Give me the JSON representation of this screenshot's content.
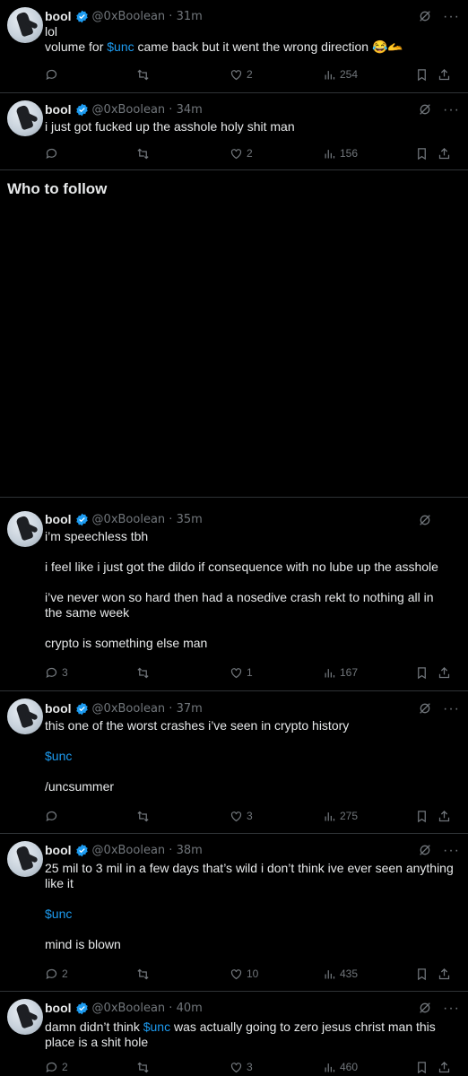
{
  "author": {
    "name": "bool",
    "handle": "@0xBoolean"
  },
  "who_to_follow": "Who to follow",
  "tweets": [
    {
      "time": "31m",
      "lines": [
        {
          "pre": "lol"
        },
        {
          "pre": "volume for ",
          "cash": "$unc",
          "post": " came back but it went the wrong direction 😂🫴"
        }
      ],
      "reply": "",
      "repost": "",
      "like": "2",
      "views": "254"
    },
    {
      "time": "34m",
      "lines": [
        {
          "pre": "i just got fucked up the asshole holy shit man"
        }
      ],
      "reply": "",
      "repost": "",
      "like": "2",
      "views": "156"
    },
    {
      "time": "35m",
      "lines": [
        {
          "pre": "i’m speechless tbh"
        },
        {
          "pre": "i feel like i just got the dildo if consequence with no lube up the asshole"
        },
        {
          "pre": "i’ve never won so hard then had a nosedive crash rekt to nothing all in the same week"
        },
        {
          "pre": "crypto is something else man"
        }
      ],
      "reply": "3",
      "repost": "",
      "like": "1",
      "views": "167"
    },
    {
      "time": "37m",
      "lines": [
        {
          "pre": "this one of the worst crashes i’ve seen in crypto history"
        },
        {
          "cash": "$unc"
        },
        {
          "pre": "/uncsummer"
        }
      ],
      "reply": "",
      "repost": "",
      "like": "3",
      "views": "275"
    },
    {
      "time": "38m",
      "lines": [
        {
          "pre": "25 mil to 3 mil in a few days that’s wild i don’t think ive ever seen anything like it"
        },
        {
          "cash": "$unc"
        },
        {
          "pre": "mind is blown"
        }
      ],
      "reply": "2",
      "repost": "",
      "like": "10",
      "views": "435"
    },
    {
      "time": "40m",
      "lines": [
        {
          "pre": "damn didn’t think ",
          "cash": "$unc",
          "post": " was actually going to zero jesus christ man this place is a shit hole"
        }
      ],
      "reply": "2",
      "repost": "",
      "like": "3",
      "views": "460"
    }
  ]
}
